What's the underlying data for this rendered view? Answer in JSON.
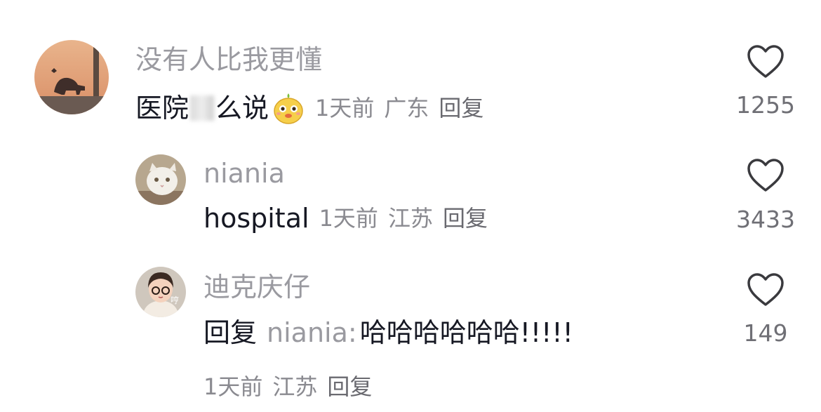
{
  "comments": [
    {
      "username": "没有人比我更懂",
      "text_before": "医院",
      "text_after": "么说",
      "time": "1天前",
      "location": "广东",
      "reply_label": "回复",
      "likes": "1255"
    },
    {
      "username": "niania",
      "text": "hospital",
      "time": "1天前",
      "location": "江苏",
      "reply_label": "回复",
      "likes": "3433"
    },
    {
      "username": "迪克庆仔",
      "reply_prefix": "回复",
      "reply_to": "niania:",
      "text": "哈哈哈哈哈哈!!!!!",
      "time": "1天前",
      "location": "江苏",
      "reply_label": "回复",
      "likes": "149",
      "avatar_badge": "哼"
    }
  ],
  "icons": {
    "like": "heart-outline-icon",
    "emoji": "chick-face-emoji-icon"
  },
  "colors": {
    "text": "#161823",
    "username": "#9a9aa0",
    "meta": "#8a8a90"
  }
}
